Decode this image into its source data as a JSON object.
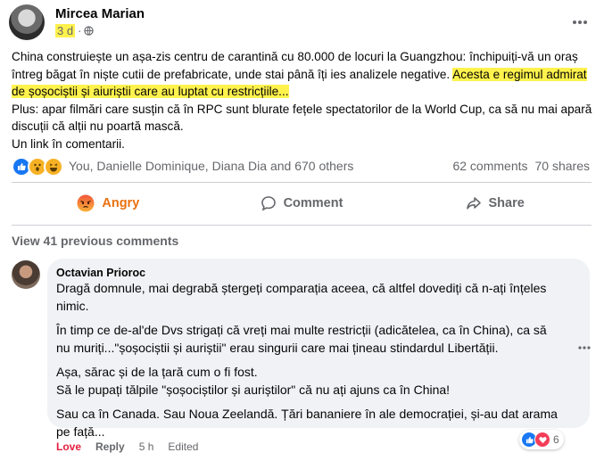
{
  "post": {
    "author": "Mircea Marian",
    "time": "3 d",
    "privacy_icon": "globe-icon",
    "text_part1": "China construiește un așa-zis centru de carantină cu 80.000 de locuri la Guangzhou: închipuiți-vă un oraș întreg băgat în niște cutii de prefabricate, unde stai până îți ies analizele negative. ",
    "text_highlight": "Acesta e regimul admirat de șoșociștii și aiuriștii care au luptat cu restricțiile...",
    "text_part2": "Plus: apar filmări care susțin că în RPC sunt blurate fețele spectatorilor de la World Cup, ca să nu mai apară discuții că alții nu poartă mască.",
    "text_part3": "Un link în comentarii.",
    "highlight_color": "#fff24d"
  },
  "reactions": {
    "icons": [
      "like-icon",
      "wow-icon",
      "haha-icon"
    ],
    "names": "You, Danielle Dominique, Diana Dia and 670 others",
    "comments_count": "62 comments",
    "shares_count": "70 shares"
  },
  "actions": {
    "angry_label": "Angry",
    "comment_label": "Comment",
    "share_label": "Share",
    "angry_color": "#e9710f"
  },
  "view_previous": "View 41 previous comments",
  "comment": {
    "author": "Octavian Prioroc",
    "para1": "Dragă domnule, mai degrabă ștergeți comparația aceea, că altfel dovediți că n-ați înțeles nimic.",
    "para2": "În timp ce de-al'de Dvs strigați că vreți mai multe restricții (adicătelea, ca în China), ca să nu muriți...\"șoșociștii și auriștii\" erau singurii care mai țineau stindardul Libertății.",
    "para3a": "Așa, sărac și de la țară cum o fi fost.",
    "para3b": "Să le pupați tălpile \"șoșociștilor și auriștilor\" că nu ați ajuns ca în China!",
    "para4": "Sau ca în Canada. Sau Noua Zeelandă. Țări bananiere în ale democrației, și-au dat arama pe față...",
    "love_label": "Love",
    "reply_label": "Reply",
    "time": "5 h",
    "edited": "Edited",
    "reaction_count": "6"
  }
}
